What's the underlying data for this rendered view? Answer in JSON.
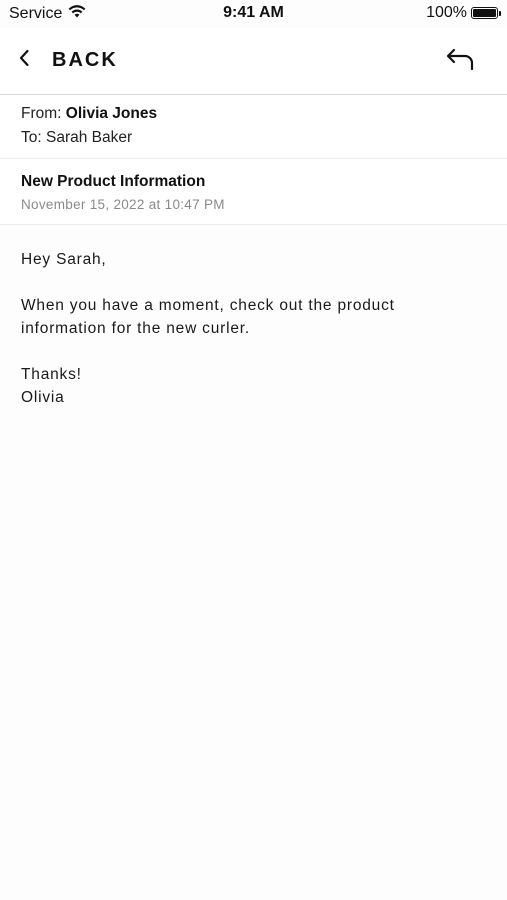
{
  "status_bar": {
    "carrier": "Service",
    "time": "9:41 AM",
    "battery": "100%",
    "battery_level": 1.0
  },
  "nav": {
    "back_label": "BACK",
    "back_icon": "chevron-left-icon",
    "reply_icon": "reply-arrow-icon"
  },
  "email": {
    "from_label": "From:",
    "from_name": "Olivia Jones",
    "to_label": "To:",
    "to_name": "Sarah Baker",
    "subject": "New Product Information",
    "date": "November 15, 2022 at 10:47 PM",
    "body": {
      "greeting": "Hey Sarah,",
      "line1": "When you have a moment, check out the product",
      "line2": "information for the new curler.",
      "closing": "Thanks!",
      "signature": "Olivia"
    }
  }
}
